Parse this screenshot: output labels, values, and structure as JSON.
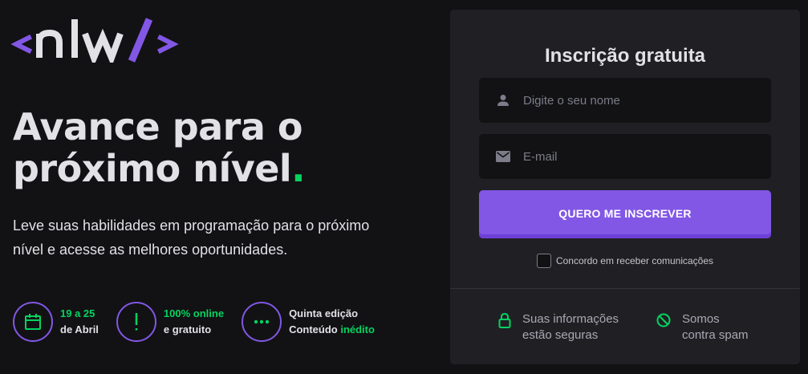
{
  "brand": {
    "logo_text": "<nlw/>"
  },
  "hero": {
    "title_line1": "Avance para o",
    "title_line2": "próximo nível",
    "title_dot": ".",
    "description": "Leve suas habilidades em programação para o próximo nível e acesse as melhores oportunidades."
  },
  "features": [
    {
      "icon": "calendar-icon",
      "line1": "19 a 25",
      "line2": "de Abril"
    },
    {
      "icon": "exclamation-icon",
      "line1": "100% online",
      "line2": "e gratuito"
    },
    {
      "icon": "ellipsis-icon",
      "line1": "Quinta edição",
      "line2_prefix": "Conteúdo ",
      "line2_highlight": "inédito"
    }
  ],
  "form": {
    "title": "Inscrição gratuita",
    "name_placeholder": "Digite o seu nome",
    "email_placeholder": "E-mail",
    "submit_label": "QUERO ME INSCREVER",
    "consent_label": "Concordo em receber comunicações",
    "consent_checked": false
  },
  "trust": [
    {
      "icon": "lock-icon",
      "line1": "Suas informações",
      "line2": "estão seguras"
    },
    {
      "icon": "no-spam-icon",
      "line1": "Somos",
      "line2": "contra spam"
    }
  ],
  "colors": {
    "background": "#121214",
    "card": "#202024",
    "accent": "#8257e5",
    "green": "#04d361",
    "text": "#e1e1e6",
    "muted": "#7c7c8a"
  }
}
